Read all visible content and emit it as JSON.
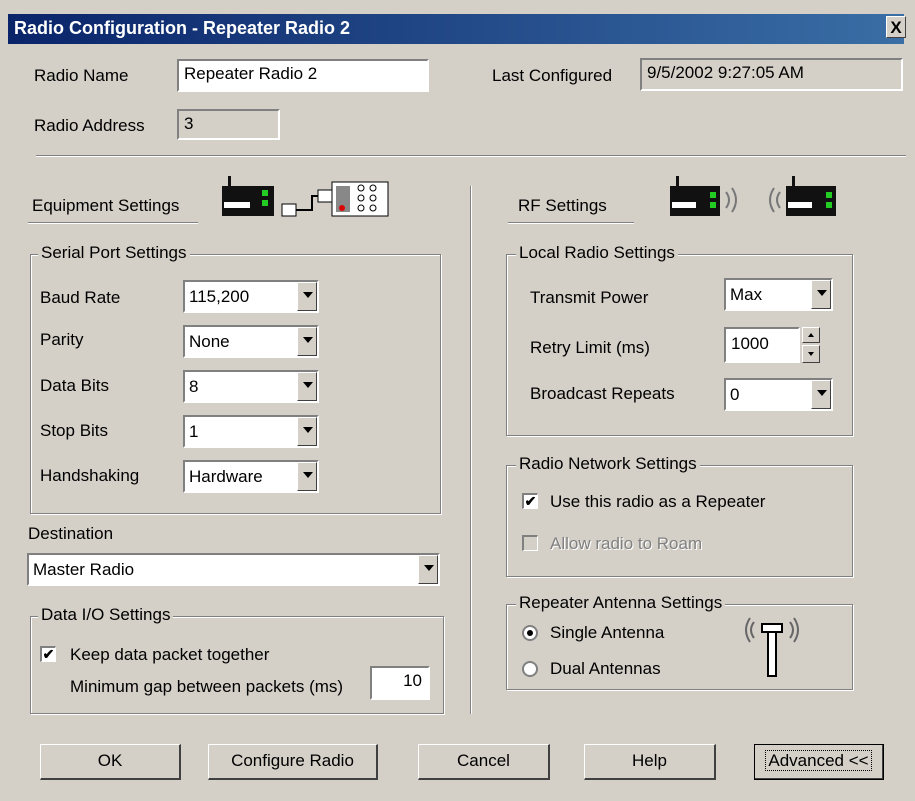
{
  "window": {
    "title": "Radio Configuration - Repeater Radio 2",
    "close_label": "X"
  },
  "header": {
    "radio_name_label": "Radio Name",
    "radio_name_value": "Repeater Radio 2",
    "radio_address_label": "Radio Address",
    "radio_address_value": "3",
    "last_configured_label": "Last Configured",
    "last_configured_value": "9/5/2002 9:27:05 AM"
  },
  "equipment": {
    "section_label": "Equipment Settings",
    "serial_group_label": "Serial Port Settings",
    "baud_rate_label": "Baud Rate",
    "baud_rate_value": "115,200",
    "parity_label": "Parity",
    "parity_value": "None",
    "data_bits_label": "Data Bits",
    "data_bits_value": "8",
    "stop_bits_label": "Stop Bits",
    "stop_bits_value": "1",
    "handshaking_label": "Handshaking",
    "handshaking_value": "Hardware",
    "destination_label": "Destination",
    "destination_value": "Master Radio",
    "data_io_group_label": "Data I/O Settings",
    "keep_together_label": "Keep data packet together",
    "keep_together_checked": true,
    "min_gap_label": "Minimum gap between packets (ms)",
    "min_gap_value": "10"
  },
  "rf": {
    "section_label": "RF Settings",
    "local_group_label": "Local Radio Settings",
    "transmit_power_label": "Transmit Power",
    "transmit_power_value": "Max",
    "retry_limit_label": "Retry Limit (ms)",
    "retry_limit_value": "1000",
    "broadcast_repeats_label": "Broadcast Repeats",
    "broadcast_repeats_value": "0",
    "network_group_label": "Radio Network Settings",
    "use_repeater_label": "Use this radio as a Repeater",
    "use_repeater_checked": true,
    "allow_roam_label": "Allow radio to Roam",
    "allow_roam_checked": false,
    "antenna_group_label": "Repeater Antenna Settings",
    "single_antenna_label": "Single Antenna",
    "dual_antennas_label": "Dual Antennas",
    "antenna_selected": "single"
  },
  "footer": {
    "ok_label": "OK",
    "configure_label": "Configure Radio",
    "cancel_label": "Cancel",
    "help_label": "Help",
    "advanced_label": "Advanced <<"
  },
  "icons": {
    "equipment": "radio-serial-connection-icon",
    "rf": "radio-to-radio-wireless-icon",
    "antenna": "antenna-icon"
  },
  "colors": {
    "title_start": "#0a246a",
    "title_end": "#3a6ea5",
    "dialog_bg": "#d4d0c8"
  }
}
